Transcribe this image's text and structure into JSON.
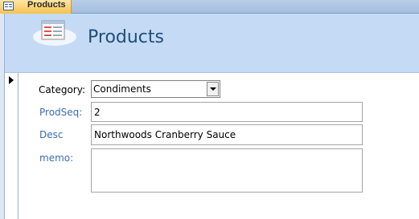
{
  "tab": {
    "label": "Products"
  },
  "header": {
    "title": "Products"
  },
  "form": {
    "category": {
      "label": "Category:",
      "value": "Condiments"
    },
    "prodseq": {
      "label": "ProdSeq:",
      "value": "2"
    },
    "desc": {
      "label": "Desc",
      "value": "Northwoods Cranberry Sauce"
    },
    "memo": {
      "label": "memo:",
      "value": ""
    }
  },
  "icons": {
    "tab": "form-icon",
    "header": "form-icon",
    "record": "current-record-arrow-icon",
    "dropdown": "chevron-down-icon"
  }
}
